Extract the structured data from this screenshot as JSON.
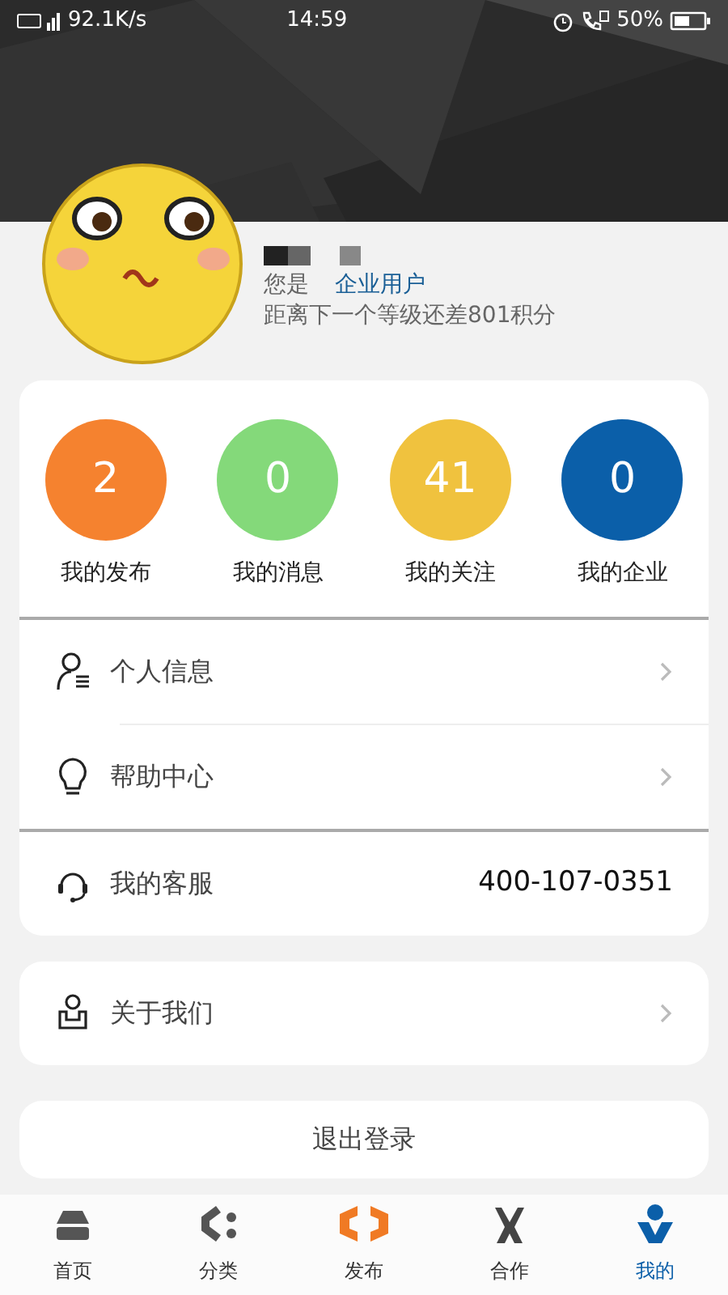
{
  "status_bar": {
    "network_speed": "92.1K/s",
    "time": "14:59",
    "battery": "50%"
  },
  "profile": {
    "role_prefix": "您是",
    "role": "企业用户",
    "points_note": "距离下一个等级还差801积分"
  },
  "stats": [
    {
      "count": "2",
      "label": "我的发布",
      "color": "#f5822f"
    },
    {
      "count": "0",
      "label": "我的消息",
      "color": "#84d97a"
    },
    {
      "count": "41",
      "label": "我的关注",
      "color": "#f0c23e"
    },
    {
      "count": "0",
      "label": "我的企业",
      "color": "#0b5fa9"
    }
  ],
  "menu": [
    {
      "kind": "link",
      "label": "个人信息"
    },
    {
      "kind": "link",
      "label": "帮助中心"
    },
    {
      "kind": "phone",
      "label": "我的客服",
      "value": "400-107-0351"
    }
  ],
  "about": {
    "kind": "link",
    "label": "关于我们"
  },
  "logout": "退出登录",
  "tabs": [
    {
      "label": "首页",
      "selected": false
    },
    {
      "label": "分类",
      "selected": false
    },
    {
      "label": "发布",
      "selected": false
    },
    {
      "label": "合作",
      "selected": false
    },
    {
      "label": "我的",
      "selected": true
    }
  ]
}
